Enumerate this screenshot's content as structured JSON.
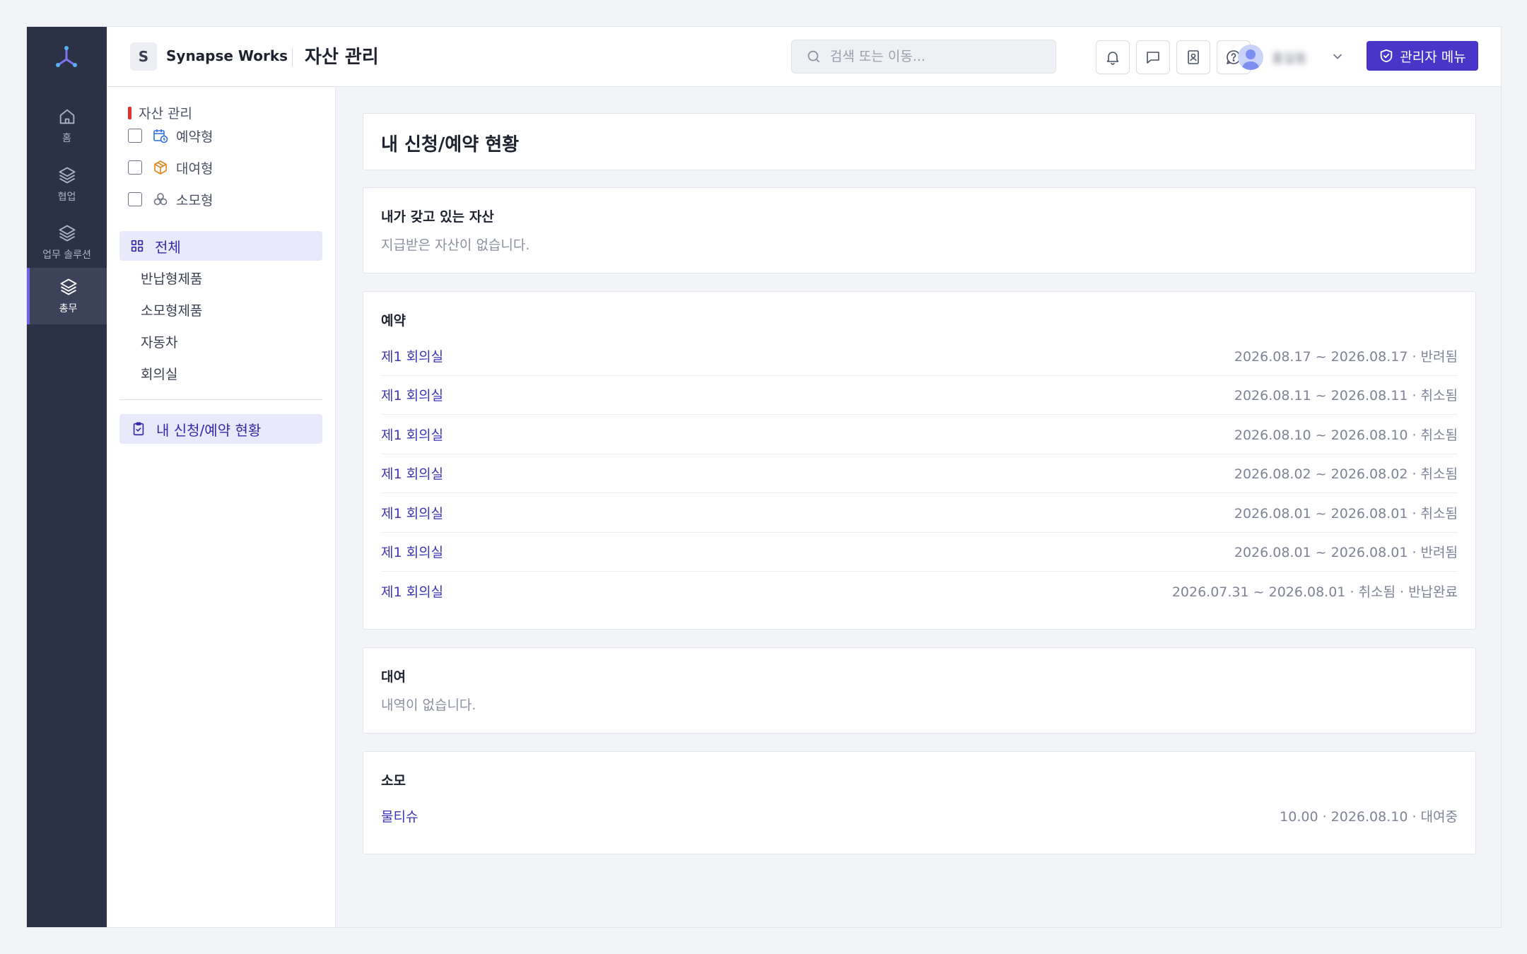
{
  "rail": {
    "items": [
      {
        "label": "홈",
        "icon": "home-icon"
      },
      {
        "label": "협업",
        "icon": "layers-icon"
      },
      {
        "label": "업무 솔루션",
        "icon": "layers-icon"
      },
      {
        "label": "총무",
        "icon": "layers-icon",
        "active": true
      }
    ]
  },
  "header": {
    "workspace_badge": "S",
    "workspace_name": "Synapse Works",
    "page_title": "자산 관리",
    "search_placeholder": "검색 또는 이동...",
    "user_name": "홍길동",
    "admin_button": "관리자 메뉴"
  },
  "sidebar": {
    "section_title": "자산 관리",
    "filters": [
      {
        "label": "예약형",
        "icon": "calendar-clock-icon"
      },
      {
        "label": "대여형",
        "icon": "box-icon"
      },
      {
        "label": "소모형",
        "icon": "circles-icon"
      }
    ],
    "all_label": "전체",
    "categories": [
      "반납형제품",
      "소모형제품",
      "자동차",
      "회의실"
    ],
    "my_status_label": "내 신청/예약 현황"
  },
  "main": {
    "page_heading": "내 신청/예약 현황",
    "owned": {
      "title": "내가 갖고 있는 자산",
      "empty": "지급받은 자산이 없습니다."
    },
    "reservations": {
      "title": "예약",
      "items": [
        {
          "name": "제1 회의실",
          "meta": "2026.08.17 ~ 2026.08.17 · 반려됨"
        },
        {
          "name": "제1 회의실",
          "meta": "2026.08.11 ~ 2026.08.11 · 취소됨"
        },
        {
          "name": "제1 회의실",
          "meta": "2026.08.10 ~ 2026.08.10 · 취소됨"
        },
        {
          "name": "제1 회의실",
          "meta": "2026.08.02 ~ 2026.08.02 · 취소됨"
        },
        {
          "name": "제1 회의실",
          "meta": "2026.08.01 ~ 2026.08.01 · 취소됨"
        },
        {
          "name": "제1 회의실",
          "meta": "2026.08.01 ~ 2026.08.01 · 반려됨"
        },
        {
          "name": "제1 회의실",
          "meta": "2026.07.31 ~ 2026.08.01 · 취소됨 · 반납완료"
        }
      ]
    },
    "rental": {
      "title": "대여",
      "empty": "내역이 없습니다."
    },
    "consumable": {
      "title": "소모",
      "items": [
        {
          "name": "물티슈",
          "meta": "10.00 · 2026.08.10 · 대여중"
        }
      ]
    }
  },
  "colors": {
    "accent": "#4a35c9",
    "rail_bg": "#2b3246",
    "section_marker": "#e03232"
  }
}
